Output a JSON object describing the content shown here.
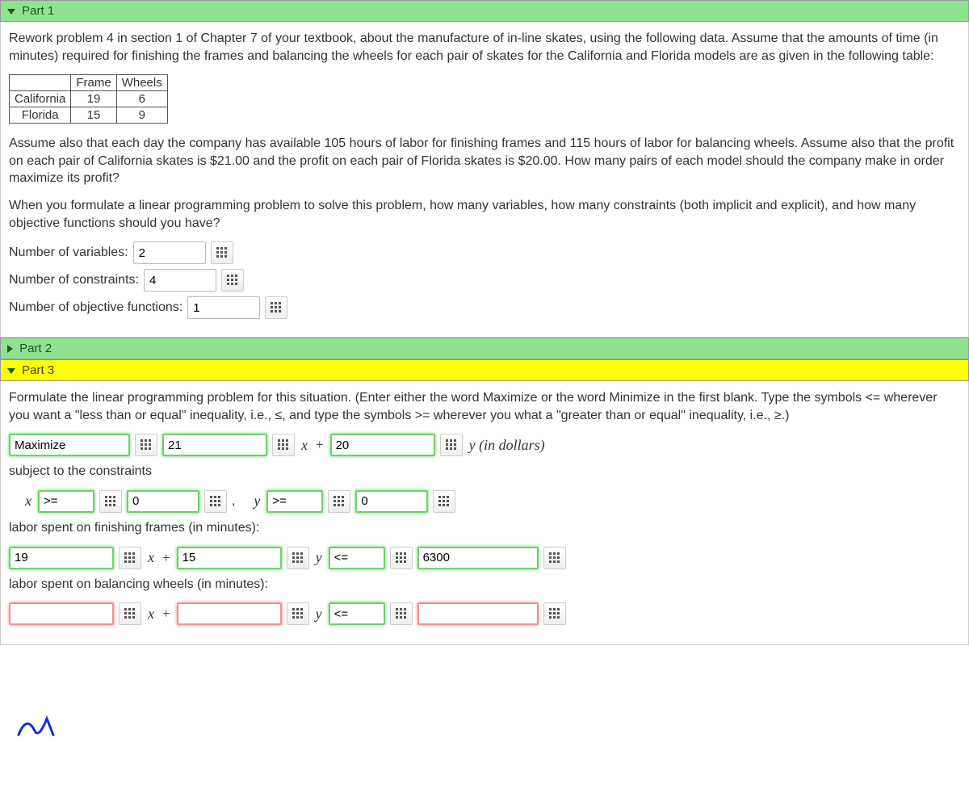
{
  "part1": {
    "title": "Part 1",
    "intro": "Rework problem 4 in section 1 of Chapter 7 of your textbook, about the manufacture of in-line skates, using the following data. Assume that the amounts of time (in minutes) required for finishing the frames and balancing the wheels for each pair of skates for the California and Florida models are as given in the following table:",
    "table": {
      "h_frame": "Frame",
      "h_wheels": "Wheels",
      "r1": "California",
      "r1c1": "19",
      "r1c2": "6",
      "r2": "Florida",
      "r2c1": "15",
      "r2c2": "9"
    },
    "para2": "Assume also that each day the company has available 105 hours of labor for finishing frames and 115 hours of labor for balancing wheels. Assume also that the profit on each pair of California skates is $21.00 and the profit on each pair of Florida skates is $20.00. How many pairs of each model should the company make in order maximize its profit?",
    "para3": "When you formulate a linear programming problem to solve this problem, how many variables, how many constraints (both implicit and explicit), and how many objective functions should you have?",
    "q_vars": "Number of variables:",
    "a_vars": "2",
    "q_cons": "Number of constraints:",
    "a_cons": "4",
    "q_obj": "Number of objective functions:",
    "a_obj": "1"
  },
  "part2": {
    "title": "Part 2"
  },
  "part3": {
    "title": "Part 3",
    "intro": "Formulate the linear programming problem for this situation. (Enter either the word Maximize or the word Minimize in the first blank. Type the symbols <= wherever you want a \"less than or equal\" inequality, i.e., ≤, and type the symbols >= wherever you what a \"greater than or equal\" inequality, i.e., ≥.)",
    "obj": {
      "word": "Maximize",
      "c1": "21",
      "c2": "20",
      "tail": "y (in dollars)"
    },
    "subject": "subject to the constraints",
    "nonneg": {
      "x_op": ">=",
      "x_rhs": "0",
      "y_op": ">=",
      "y_rhs": "0"
    },
    "frame": {
      "label": "labor spent on finishing frames (in minutes):",
      "c1": "19",
      "c2": "15",
      "op": "<=",
      "rhs": "6300"
    },
    "wheels": {
      "label": "labor spent on balancing wheels (in minutes):",
      "c1": "",
      "c2": "",
      "op": "<=",
      "rhs": ""
    }
  },
  "comma": ","
}
